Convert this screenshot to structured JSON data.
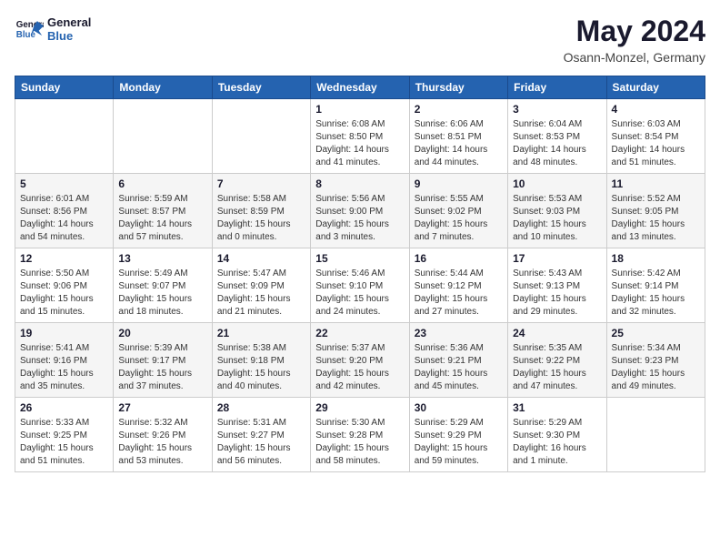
{
  "header": {
    "logo": {
      "line1": "General",
      "line2": "Blue"
    },
    "month": "May 2024",
    "location": "Osann-Monzel, Germany"
  },
  "weekdays": [
    "Sunday",
    "Monday",
    "Tuesday",
    "Wednesday",
    "Thursday",
    "Friday",
    "Saturday"
  ],
  "weeks": [
    [
      {
        "day": "",
        "info": ""
      },
      {
        "day": "",
        "info": ""
      },
      {
        "day": "",
        "info": ""
      },
      {
        "day": "1",
        "info": "Sunrise: 6:08 AM\nSunset: 8:50 PM\nDaylight: 14 hours\nand 41 minutes."
      },
      {
        "day": "2",
        "info": "Sunrise: 6:06 AM\nSunset: 8:51 PM\nDaylight: 14 hours\nand 44 minutes."
      },
      {
        "day": "3",
        "info": "Sunrise: 6:04 AM\nSunset: 8:53 PM\nDaylight: 14 hours\nand 48 minutes."
      },
      {
        "day": "4",
        "info": "Sunrise: 6:03 AM\nSunset: 8:54 PM\nDaylight: 14 hours\nand 51 minutes."
      }
    ],
    [
      {
        "day": "5",
        "info": "Sunrise: 6:01 AM\nSunset: 8:56 PM\nDaylight: 14 hours\nand 54 minutes."
      },
      {
        "day": "6",
        "info": "Sunrise: 5:59 AM\nSunset: 8:57 PM\nDaylight: 14 hours\nand 57 minutes."
      },
      {
        "day": "7",
        "info": "Sunrise: 5:58 AM\nSunset: 8:59 PM\nDaylight: 15 hours\nand 0 minutes."
      },
      {
        "day": "8",
        "info": "Sunrise: 5:56 AM\nSunset: 9:00 PM\nDaylight: 15 hours\nand 3 minutes."
      },
      {
        "day": "9",
        "info": "Sunrise: 5:55 AM\nSunset: 9:02 PM\nDaylight: 15 hours\nand 7 minutes."
      },
      {
        "day": "10",
        "info": "Sunrise: 5:53 AM\nSunset: 9:03 PM\nDaylight: 15 hours\nand 10 minutes."
      },
      {
        "day": "11",
        "info": "Sunrise: 5:52 AM\nSunset: 9:05 PM\nDaylight: 15 hours\nand 13 minutes."
      }
    ],
    [
      {
        "day": "12",
        "info": "Sunrise: 5:50 AM\nSunset: 9:06 PM\nDaylight: 15 hours\nand 15 minutes."
      },
      {
        "day": "13",
        "info": "Sunrise: 5:49 AM\nSunset: 9:07 PM\nDaylight: 15 hours\nand 18 minutes."
      },
      {
        "day": "14",
        "info": "Sunrise: 5:47 AM\nSunset: 9:09 PM\nDaylight: 15 hours\nand 21 minutes."
      },
      {
        "day": "15",
        "info": "Sunrise: 5:46 AM\nSunset: 9:10 PM\nDaylight: 15 hours\nand 24 minutes."
      },
      {
        "day": "16",
        "info": "Sunrise: 5:44 AM\nSunset: 9:12 PM\nDaylight: 15 hours\nand 27 minutes."
      },
      {
        "day": "17",
        "info": "Sunrise: 5:43 AM\nSunset: 9:13 PM\nDaylight: 15 hours\nand 29 minutes."
      },
      {
        "day": "18",
        "info": "Sunrise: 5:42 AM\nSunset: 9:14 PM\nDaylight: 15 hours\nand 32 minutes."
      }
    ],
    [
      {
        "day": "19",
        "info": "Sunrise: 5:41 AM\nSunset: 9:16 PM\nDaylight: 15 hours\nand 35 minutes."
      },
      {
        "day": "20",
        "info": "Sunrise: 5:39 AM\nSunset: 9:17 PM\nDaylight: 15 hours\nand 37 minutes."
      },
      {
        "day": "21",
        "info": "Sunrise: 5:38 AM\nSunset: 9:18 PM\nDaylight: 15 hours\nand 40 minutes."
      },
      {
        "day": "22",
        "info": "Sunrise: 5:37 AM\nSunset: 9:20 PM\nDaylight: 15 hours\nand 42 minutes."
      },
      {
        "day": "23",
        "info": "Sunrise: 5:36 AM\nSunset: 9:21 PM\nDaylight: 15 hours\nand 45 minutes."
      },
      {
        "day": "24",
        "info": "Sunrise: 5:35 AM\nSunset: 9:22 PM\nDaylight: 15 hours\nand 47 minutes."
      },
      {
        "day": "25",
        "info": "Sunrise: 5:34 AM\nSunset: 9:23 PM\nDaylight: 15 hours\nand 49 minutes."
      }
    ],
    [
      {
        "day": "26",
        "info": "Sunrise: 5:33 AM\nSunset: 9:25 PM\nDaylight: 15 hours\nand 51 minutes."
      },
      {
        "day": "27",
        "info": "Sunrise: 5:32 AM\nSunset: 9:26 PM\nDaylight: 15 hours\nand 53 minutes."
      },
      {
        "day": "28",
        "info": "Sunrise: 5:31 AM\nSunset: 9:27 PM\nDaylight: 15 hours\nand 56 minutes."
      },
      {
        "day": "29",
        "info": "Sunrise: 5:30 AM\nSunset: 9:28 PM\nDaylight: 15 hours\nand 58 minutes."
      },
      {
        "day": "30",
        "info": "Sunrise: 5:29 AM\nSunset: 9:29 PM\nDaylight: 15 hours\nand 59 minutes."
      },
      {
        "day": "31",
        "info": "Sunrise: 5:29 AM\nSunset: 9:30 PM\nDaylight: 16 hours\nand 1 minute."
      },
      {
        "day": "",
        "info": ""
      }
    ]
  ]
}
